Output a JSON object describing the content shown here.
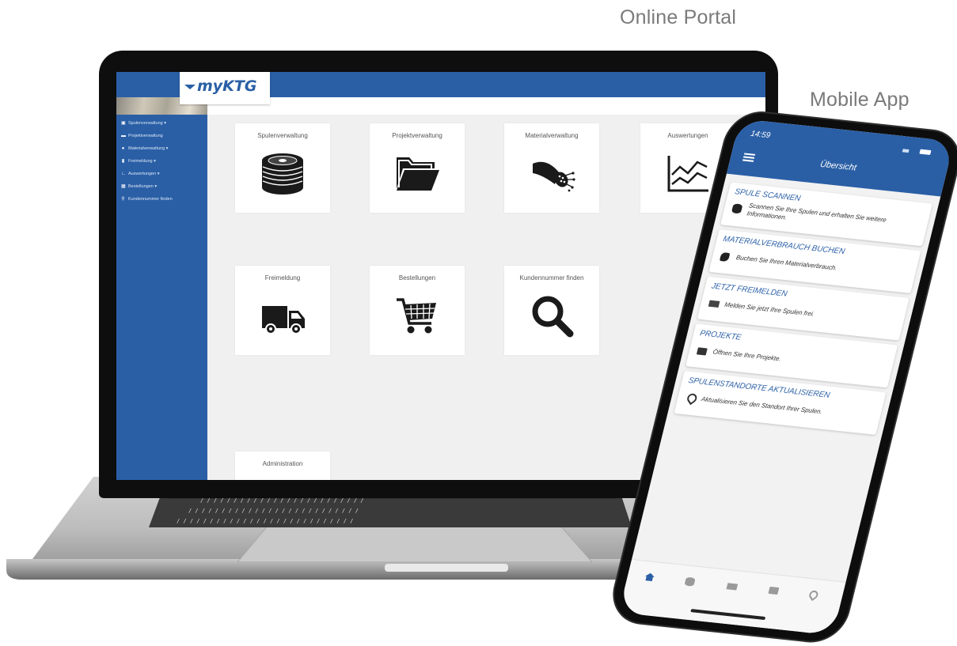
{
  "captions": {
    "portal": "Online Portal",
    "app": "Mobile App"
  },
  "portal": {
    "logo": "myKTG",
    "sidebar": [
      {
        "icon": "spool-icon",
        "label": "Spulenverwaltung ▾"
      },
      {
        "icon": "folder-icon",
        "label": "Projektverwaltung"
      },
      {
        "icon": "cable-icon",
        "label": "Materialverwaltung ▾"
      },
      {
        "icon": "truck-icon",
        "label": "Freimeldung ▾"
      },
      {
        "icon": "chart-icon",
        "label": "Auswertungen ▾"
      },
      {
        "icon": "cart-icon",
        "label": "Bestellungen ▾"
      },
      {
        "icon": "search-icon",
        "label": "Kundennummer finden"
      }
    ],
    "tiles": [
      {
        "title": "Spulenverwaltung",
        "icon": "spool-icon"
      },
      {
        "title": "Projektverwaltung",
        "icon": "folder-icon"
      },
      {
        "title": "Materialverwaltung",
        "icon": "fiber-cable-icon"
      },
      {
        "title": "Auswertungen",
        "icon": "line-chart-icon"
      },
      {
        "title": "Freimeldung",
        "icon": "truck-icon"
      },
      {
        "title": "Bestellungen",
        "icon": "cart-icon"
      },
      {
        "title": "Kundennummer finden",
        "icon": "search-icon"
      },
      {
        "title": "Administration",
        "icon": ""
      }
    ]
  },
  "app": {
    "time": "14:59",
    "title": "Übersicht",
    "cards": [
      {
        "heading": "SPULE SCANNEN",
        "text": "Scannen Sie Ihre Spulen und erhalten Sie weitere Informationen.",
        "icon": "spool-icon"
      },
      {
        "heading": "MATERIALVERBRAUCH BUCHEN",
        "text": "Buchen Sie Ihren Materialverbrauch.",
        "icon": "cable-icon"
      },
      {
        "heading": "JETZT FREIMELDEN",
        "text": "Melden Sie jetzt Ihre Spulen frei.",
        "icon": "truck-icon"
      },
      {
        "heading": "PROJEKTE",
        "text": "Öffnen Sie Ihre Projekte.",
        "icon": "folder-icon"
      },
      {
        "heading": "SPULENSTANDORTE AKTUALISIEREN",
        "text": "Aktualisieren Sie den Standort Ihrer Spulen.",
        "icon": "location-pin-icon"
      }
    ],
    "tabbar": [
      "home-icon",
      "spool-icon",
      "truck-icon",
      "folder-icon",
      "location-pin-icon"
    ]
  }
}
